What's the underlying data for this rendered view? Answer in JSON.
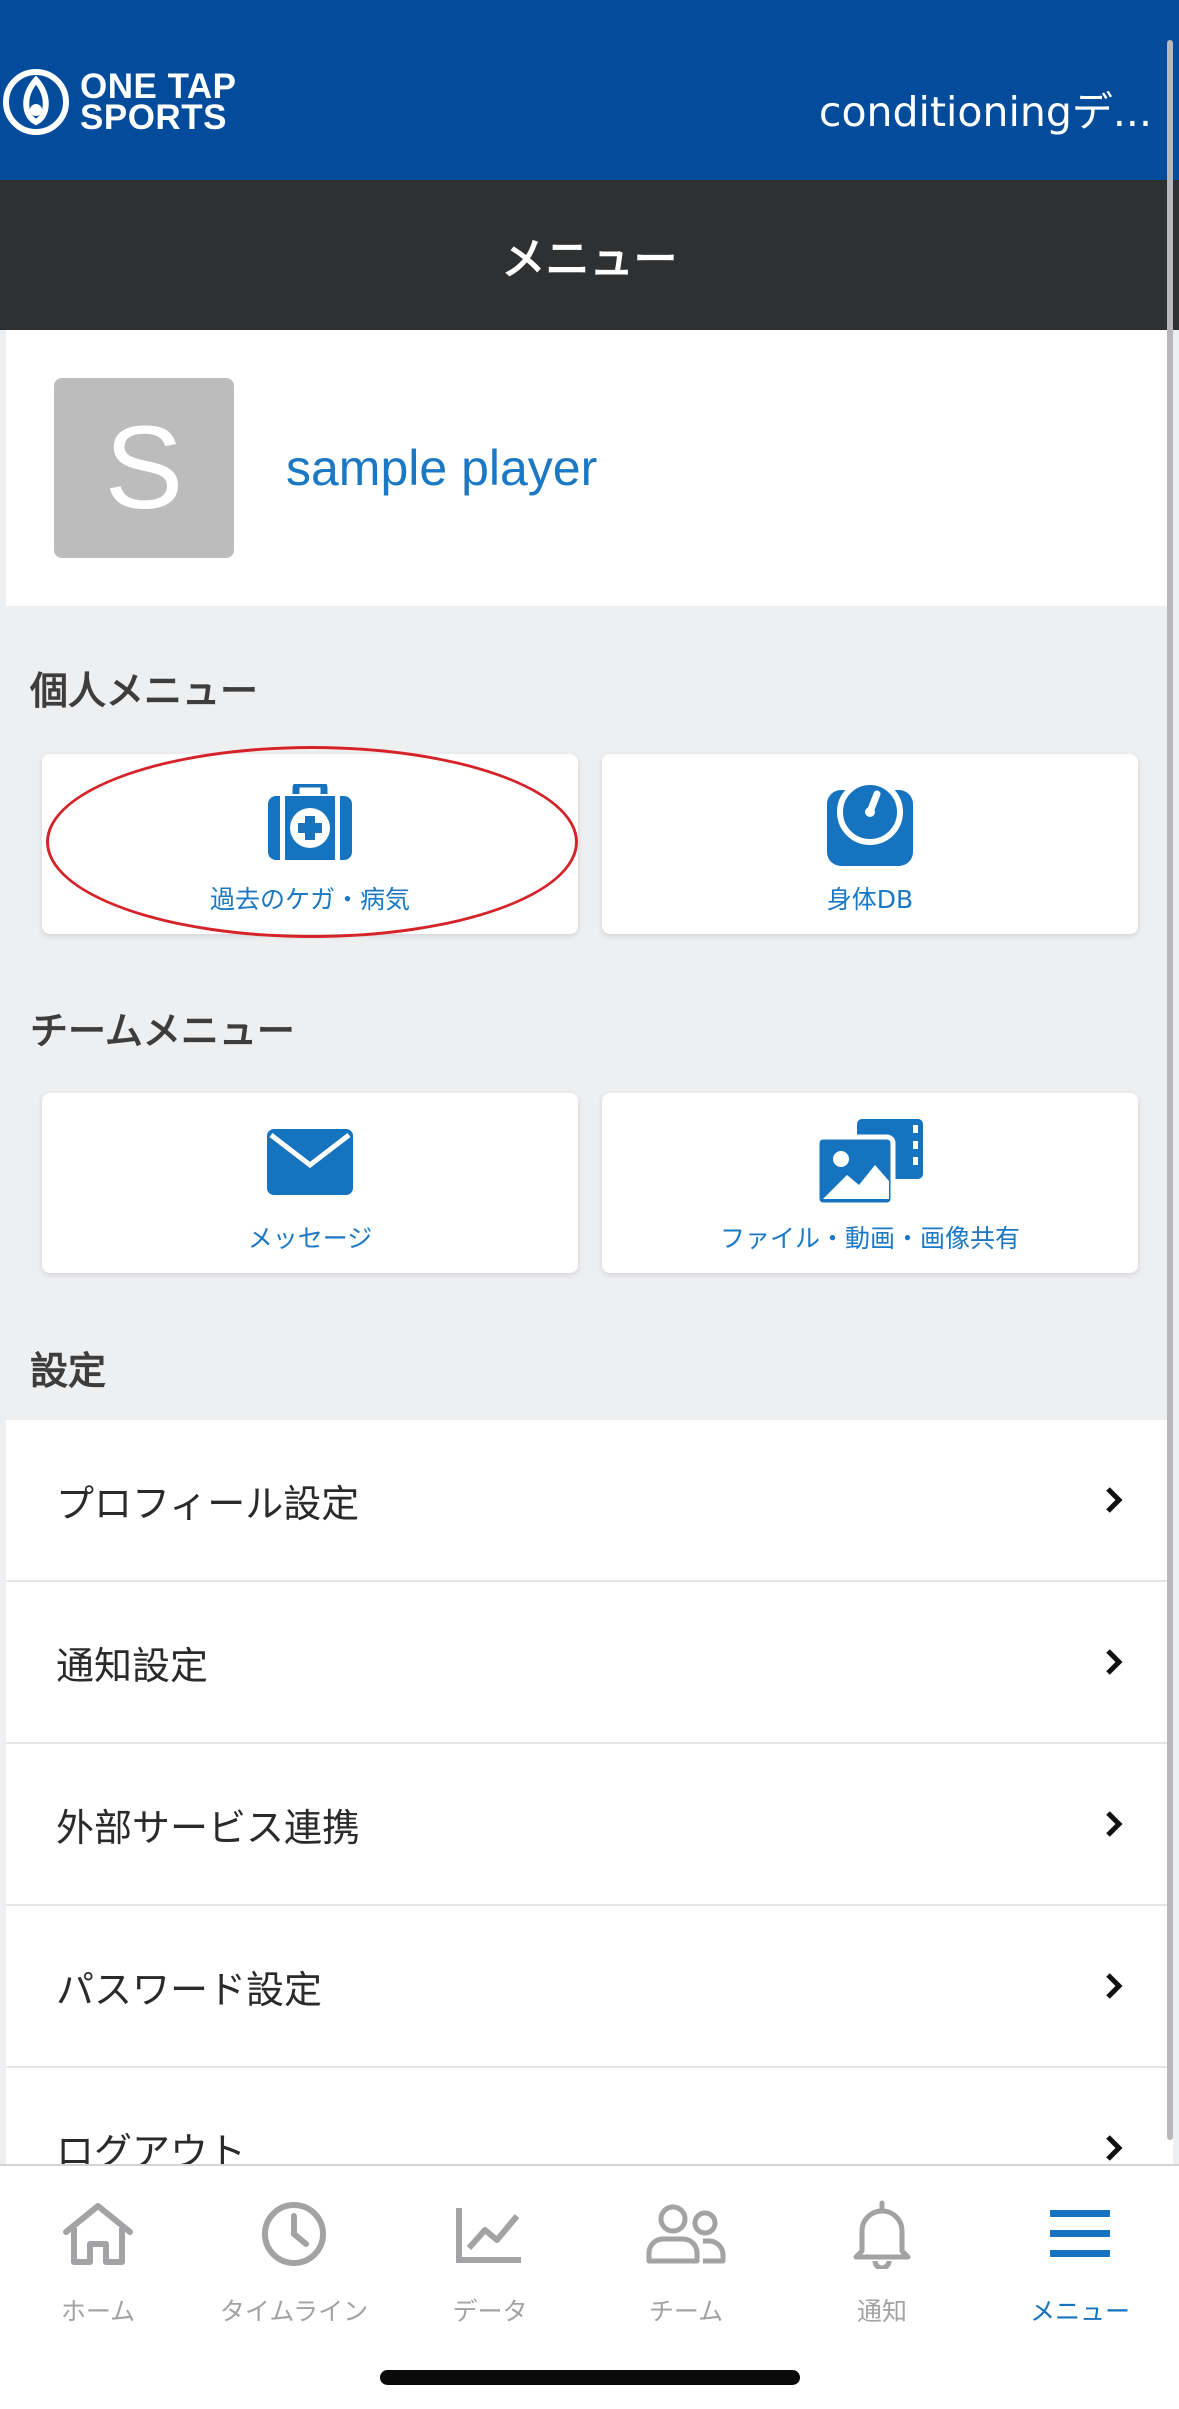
{
  "header": {
    "logo_line1": "ONE TAP",
    "logo_line2": "SPORTS",
    "team_name": "conditioningデ..."
  },
  "title": "メニュー",
  "profile": {
    "avatar_initial": "S",
    "name": "sample player"
  },
  "personal_menu": {
    "heading": "個人メニュー",
    "items": [
      {
        "label": "過去のケガ・病気",
        "icon": "medical-kit-icon"
      },
      {
        "label": "身体DB",
        "icon": "scale-icon"
      }
    ]
  },
  "team_menu": {
    "heading": "チームメニュー",
    "items": [
      {
        "label": "メッセージ",
        "icon": "envelope-icon"
      },
      {
        "label": "ファイル・動画・画像共有",
        "icon": "media-share-icon"
      }
    ]
  },
  "settings": {
    "heading": "設定",
    "items": [
      {
        "label": "プロフィール設定"
      },
      {
        "label": "通知設定"
      },
      {
        "label": "外部サービス連携"
      },
      {
        "label": "パスワード設定"
      },
      {
        "label": "ログアウト"
      }
    ]
  },
  "tab_bar": {
    "items": [
      {
        "label": "ホーム",
        "icon": "home-icon",
        "active": false
      },
      {
        "label": "タイムライン",
        "icon": "clock-icon",
        "active": false
      },
      {
        "label": "データ",
        "icon": "chart-icon",
        "active": false
      },
      {
        "label": "チーム",
        "icon": "people-icon",
        "active": false
      },
      {
        "label": "通知",
        "icon": "bell-icon",
        "active": false
      },
      {
        "label": "メニュー",
        "icon": "hamburger-icon",
        "active": true
      }
    ]
  },
  "colors": {
    "brand_blue": "#034c9c",
    "accent_blue": "#1b78c4",
    "title_bar": "#2e3032",
    "highlight_red": "#d6232a"
  }
}
